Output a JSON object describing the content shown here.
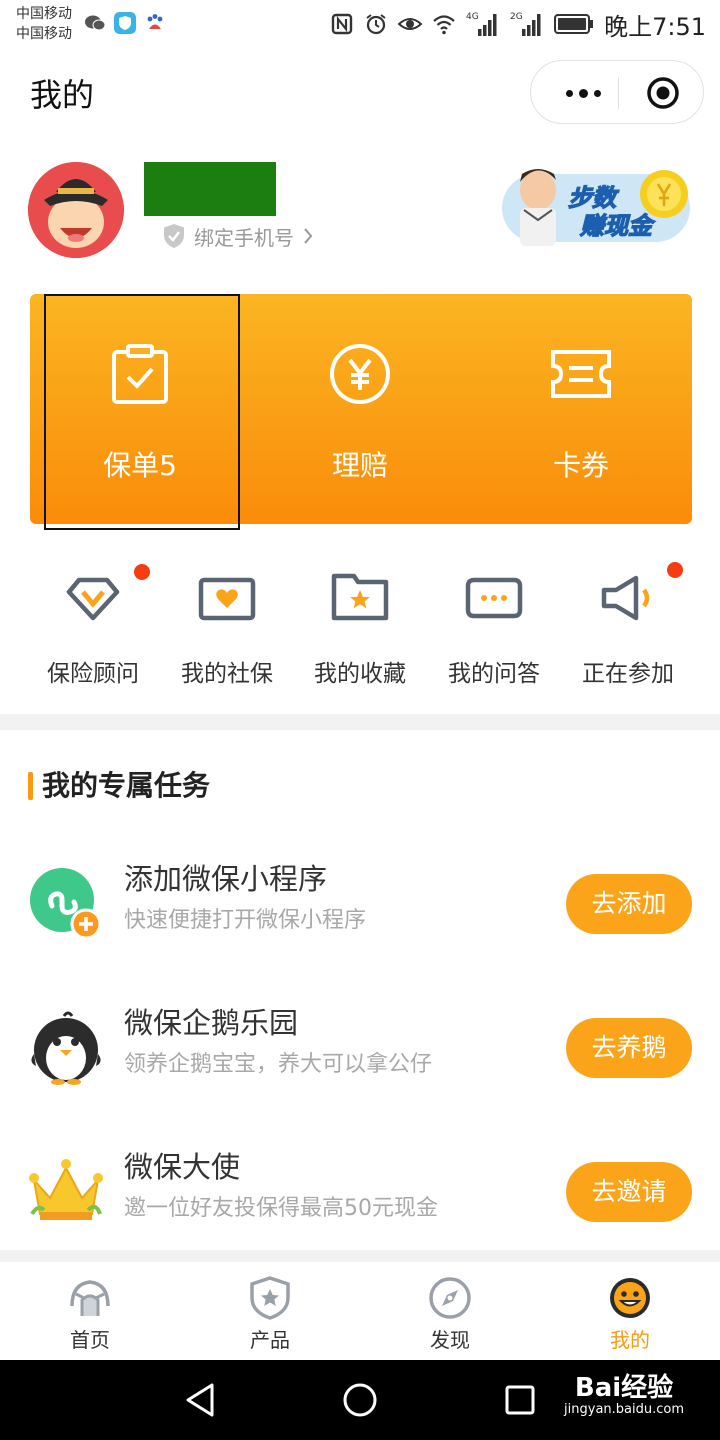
{
  "status_bar": {
    "carrier_1": "中国移动",
    "carrier_2": "中国移动",
    "network_1": "4G",
    "network_2": "2G",
    "time": "晚上7:51"
  },
  "header": {
    "title": "我的",
    "more_icon": "more-dots-icon",
    "close_icon": "target-close-icon"
  },
  "profile": {
    "bind_phone_label": "绑定手机号",
    "promo_text_1": "步数",
    "promo_text_2": "赚现金"
  },
  "card": {
    "items": [
      {
        "label": "保单5",
        "icon": "clipboard-check-icon"
      },
      {
        "label": "理赔",
        "icon": "yen-circle-icon"
      },
      {
        "label": "卡券",
        "icon": "ticket-icon"
      }
    ]
  },
  "quick": {
    "items": [
      {
        "label": "保险顾问",
        "icon": "diamond-icon",
        "badge": true
      },
      {
        "label": "我的社保",
        "icon": "heart-card-icon",
        "badge": false
      },
      {
        "label": "我的收藏",
        "icon": "star-folder-icon",
        "badge": false
      },
      {
        "label": "我的问答",
        "icon": "chat-bubble-icon",
        "badge": false
      },
      {
        "label": "正在参加",
        "icon": "megaphone-icon",
        "badge": true
      }
    ]
  },
  "tasks": {
    "section_title": "我的专属任务",
    "items": [
      {
        "title": "添加微保小程序",
        "subtitle": "快速便捷打开微保小程序",
        "button": "去添加",
        "icon": "mini-program-icon"
      },
      {
        "title": "微保企鹅乐园",
        "subtitle": "领养企鹅宝宝，养大可以拿公仔",
        "button": "去养鹅",
        "icon": "penguin-icon"
      },
      {
        "title": "微保大使",
        "subtitle": "邀一位好友投保得最高50元现金",
        "button": "去邀请",
        "icon": "crown-icon"
      }
    ]
  },
  "tabbar": {
    "items": [
      {
        "label": "首页",
        "icon": "home-icon",
        "active": false
      },
      {
        "label": "产品",
        "icon": "shield-star-icon",
        "active": false
      },
      {
        "label": "发现",
        "icon": "compass-icon",
        "active": false
      },
      {
        "label": "我的",
        "icon": "smiley-icon",
        "active": true
      }
    ]
  },
  "watermark": {
    "brand": "Bai经验",
    "url": "jingyan.baidu.com"
  },
  "colors": {
    "accent": "#fa9a10",
    "card_top": "#fbb522",
    "card_bottom": "#fa8c0a",
    "badge": "#f53c12"
  }
}
